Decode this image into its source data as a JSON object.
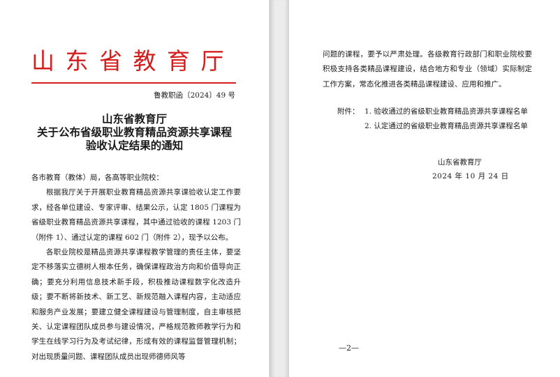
{
  "left_page": {
    "org_header": "山东省教育厅",
    "doc_number": "鲁教职函〔2024〕49 号",
    "title_lines": [
      "山东省教育厅",
      "关于公布省级职业教育精品资源共享课程",
      "验收认定结果的通知"
    ],
    "addressee": "各市教育（教体）局，各高等职业院校：",
    "paragraph_1": "根据我厅关于开展职业教育精品资源共享课验收认定工作要求，经各单位建设、专家评审、结果公示，认定 1805 门课程为省级职业教育精品资源共享课程，其中通过验收的课程 1203 门（附件 1）、通过认定的课程 602 门（附件 2），现予以公布。",
    "paragraph_2": "各职业院校是精品资源共享课程教学管理的责任主体，要坚定不移落实立德树人根本任务，确保课程政治方向和价值导向正确；要充分利用信息技术新手段，积极推动课程数字化改造升级；要不断将新技术、新工艺、新规范融入课程内容，主动适应和服务产业发展；要建立健全课程建设与管理制度，自主审核把关、认定课程团队成员参与建设情况，严格规范教师教学行为和学生在线学习行为及考试纪律，形成有效的课程监督管理机制；对出现质量问题、课程团队成员出现师德师风等"
  },
  "right_page": {
    "paragraph_cont": "问题的课程，要予以严肃处理。各级教育行政部门和职业院校要积极支持各类精品课程建设，结合地方和专业（领域）实际制定工作方案，常态化推进各类精品课程建设、应用和推广。",
    "attachment_label": "附件：",
    "attachments": [
      "1. 验收通过的省级职业教育精品资源共享课程名单",
      "2. 认定通过的省级职业教育精品资源共享课程名单"
    ],
    "signature_org": "山东省教育厅",
    "signature_date": "2024 年 10 月 24 日",
    "page_number": "—2—"
  },
  "colors": {
    "header_red": "#d61d1d",
    "text": "#1a1a1a",
    "gutter": "#ececec"
  }
}
